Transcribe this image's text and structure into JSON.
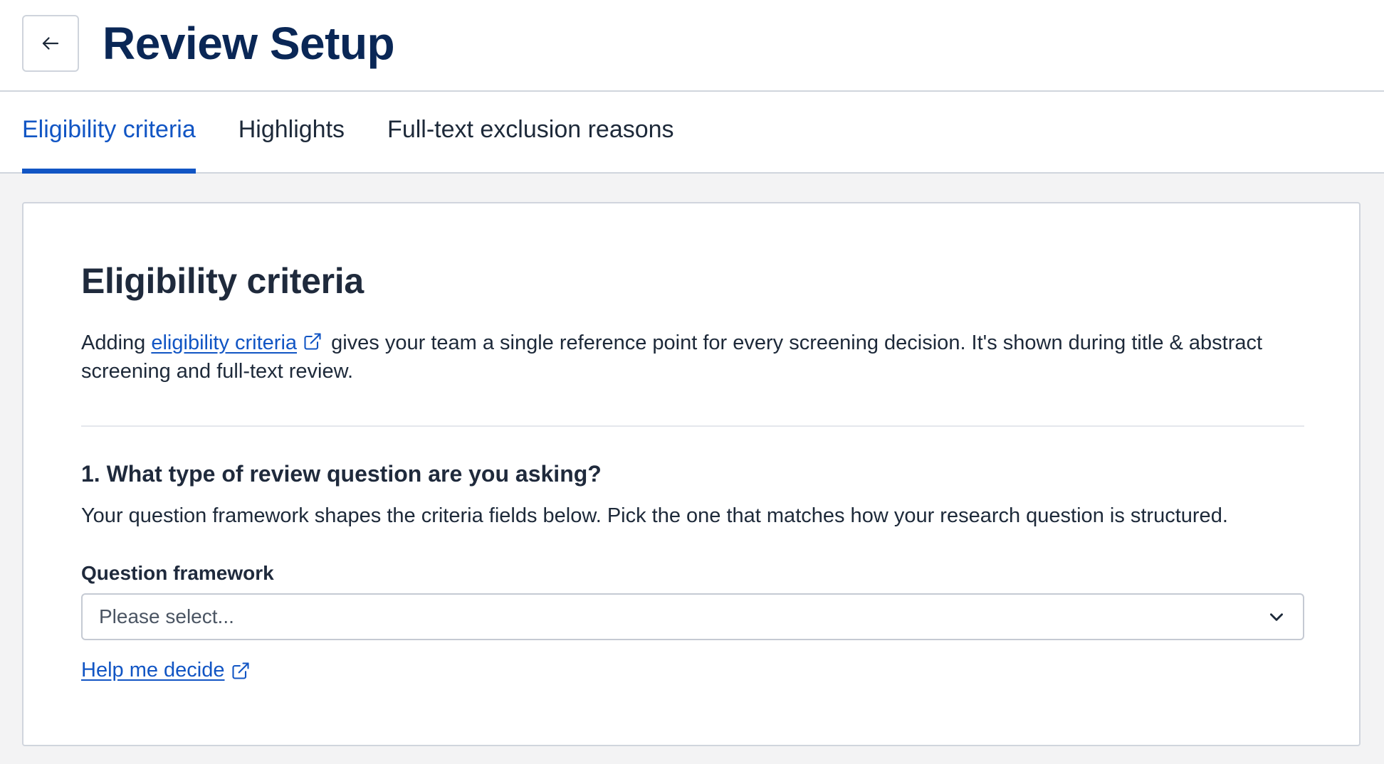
{
  "header": {
    "back_icon": "arrow-left-icon",
    "title": "Review Setup"
  },
  "tabs": [
    {
      "label": "Eligibility criteria",
      "active": true
    },
    {
      "label": "Highlights",
      "active": false
    },
    {
      "label": "Full-text exclusion reasons",
      "active": false
    }
  ],
  "card": {
    "title": "Eligibility criteria",
    "intro": {
      "before_link": "Adding ",
      "link_text": "eligibility criteria",
      "link_icon": "external-link-icon",
      "after_link": " gives your team a single reference point for every screening decision. It's shown during title & abstract screening and full-text review."
    },
    "question": {
      "heading": "1. What type of review question are you asking?",
      "description": "Your question framework shapes the criteria fields below. Pick the one that matches how your research question is structured.",
      "field_label": "Question framework",
      "select_placeholder": "Please select...",
      "select_icon": "chevron-down-icon",
      "help_link_text": "Help me decide",
      "help_link_icon": "external-link-icon"
    }
  },
  "colors": {
    "accent": "#1155c4",
    "title": "#0a2756",
    "background": "#f3f3f4"
  }
}
